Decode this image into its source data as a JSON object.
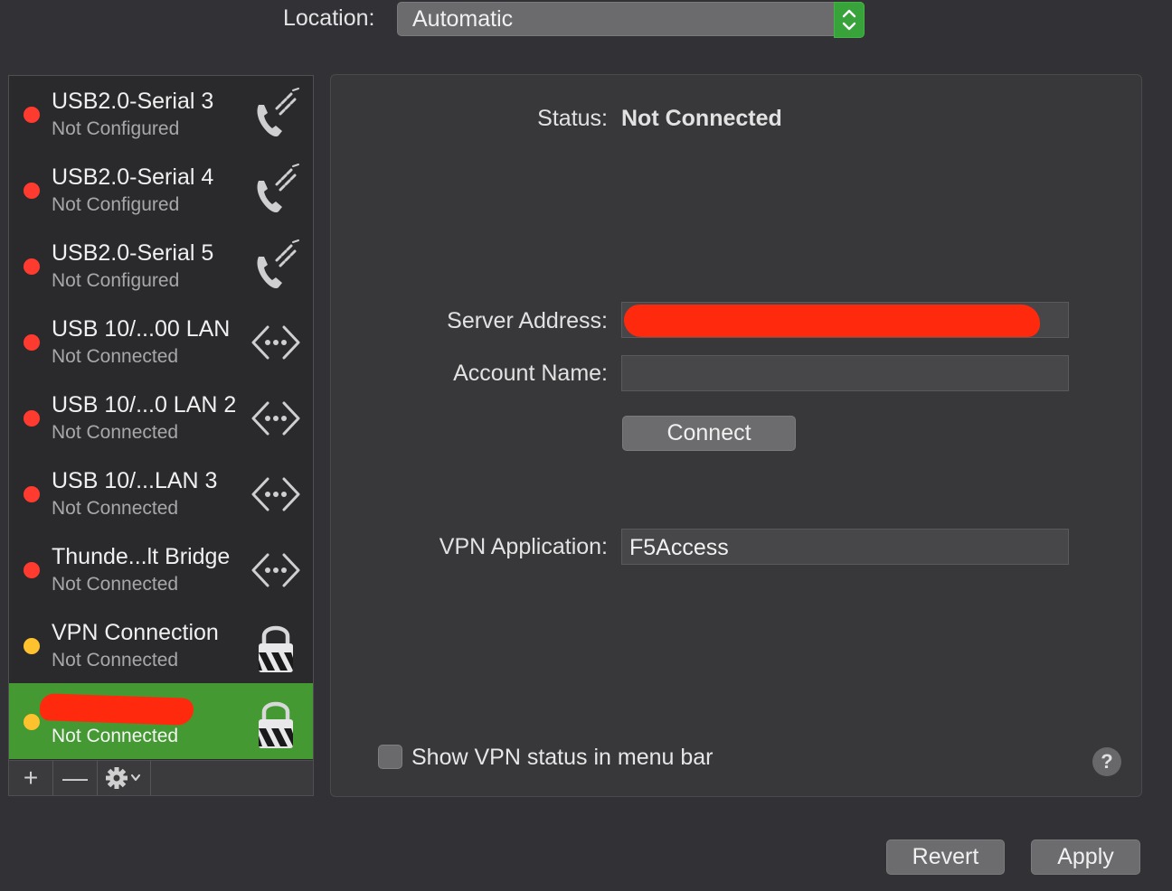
{
  "location": {
    "label": "Location:",
    "value": "Automatic"
  },
  "services": [
    {
      "name": "USB2.0-Serial 3",
      "status": "Not Configured",
      "dot": "#ff3b30",
      "icon": "phone-modem"
    },
    {
      "name": "USB2.0-Serial 4",
      "status": "Not Configured",
      "dot": "#ff3b30",
      "icon": "phone-modem"
    },
    {
      "name": "USB2.0-Serial 5",
      "status": "Not Configured",
      "dot": "#ff3b30",
      "icon": "phone-modem"
    },
    {
      "name": "USB 10/...00 LAN",
      "status": "Not Connected",
      "dot": "#ff3b30",
      "icon": "ethernet"
    },
    {
      "name": "USB 10/...0 LAN 2",
      "status": "Not Connected",
      "dot": "#ff3b30",
      "icon": "ethernet"
    },
    {
      "name": "USB 10/...LAN 3",
      "status": "Not Connected",
      "dot": "#ff3b30",
      "icon": "ethernet"
    },
    {
      "name": "Thunde...lt Bridge",
      "status": "Not Connected",
      "dot": "#ff3b30",
      "icon": "ethernet"
    },
    {
      "name": "VPN Connection",
      "status": "Not Connected",
      "dot": "#fec22e",
      "icon": "vpn-lock"
    },
    {
      "name": "",
      "status": "Not Connected",
      "dot": "#fec22e",
      "icon": "vpn-lock",
      "redacted": true
    }
  ],
  "toolbar": {
    "add": "+",
    "remove": "—"
  },
  "detail": {
    "status_label": "Status:",
    "status_value": "Not Connected",
    "server_label": "Server Address:",
    "account_label": "Account Name:",
    "account_value": "",
    "connect_label": "Connect",
    "app_label": "VPN Application:",
    "app_value": "F5Access",
    "show_status_label": "Show VPN status in menu bar",
    "help": "?"
  },
  "footer": {
    "revert": "Revert",
    "apply": "Apply"
  },
  "colors": {
    "selected_row": "#449932",
    "accent_green": "#37a33a",
    "redaction": "#ff2a0d"
  }
}
